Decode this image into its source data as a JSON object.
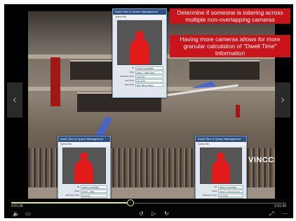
{
  "callouts": {
    "top": "Determine if someone is loitering across multiple non-overlapping cameras",
    "bottom": "Having more cameras allows for more granular calculation of \"Dwell Time\" Information"
  },
  "scene": {
    "store_sign": "VINCCI"
  },
  "panels": {
    "top": {
      "title": "Dwell Time & Queue Management",
      "subtitle": "Query Info",
      "rows": [
        {
          "label": "ID",
          "value": "CR01xxx0379496"
        },
        {
          "label": "Area",
          "value": "Area 1 - Mall, Rear"
        },
        {
          "label": "Entrance Time",
          "value": "14:07:01"
        },
        {
          "label": "Exit Time",
          "value": "14:12:33"
        },
        {
          "label": "Total Time",
          "value": "00hr 05min 32sec"
        }
      ]
    },
    "left": {
      "title": "Dwell Time & Queue Management",
      "subtitle": "Query Info",
      "rows": [
        {
          "label": "ID",
          "value": "CR01xxx0379496"
        },
        {
          "label": "Area",
          "value": "Area 2 - Mall"
        },
        {
          "label": "Entrance Time",
          "value": "14:02:11"
        },
        {
          "label": "Exit Time",
          "value": "14:06:48"
        },
        {
          "label": "Total Time",
          "value": "00hr 04min 37sec"
        }
      ]
    },
    "right": {
      "title": "Dwell Time & Queue Management",
      "subtitle": "Query Info",
      "rows": [
        {
          "label": "ID",
          "value": "CR01xxx0379496"
        },
        {
          "label": "Area",
          "value": "Area 3 - Centre Court"
        },
        {
          "label": "Entrance Time",
          "value": "14:13:02"
        },
        {
          "label": "Exit Time",
          "value": "14:16:20"
        },
        {
          "label": "Total Time",
          "value": "00hr 03min 18sec"
        }
      ]
    }
  },
  "player": {
    "elapsed": "0:01:28",
    "duration": "0:01:49",
    "progress": 0.43,
    "prev_glyph": "‹",
    "next_glyph": "›",
    "volume_glyph": "🔈",
    "captions_glyph": "▭",
    "back_glyph": "↺",
    "play_glyph": "▷",
    "forward_glyph": "↻",
    "fullscreen_glyph": "⤢",
    "more_glyph": "⋯"
  }
}
